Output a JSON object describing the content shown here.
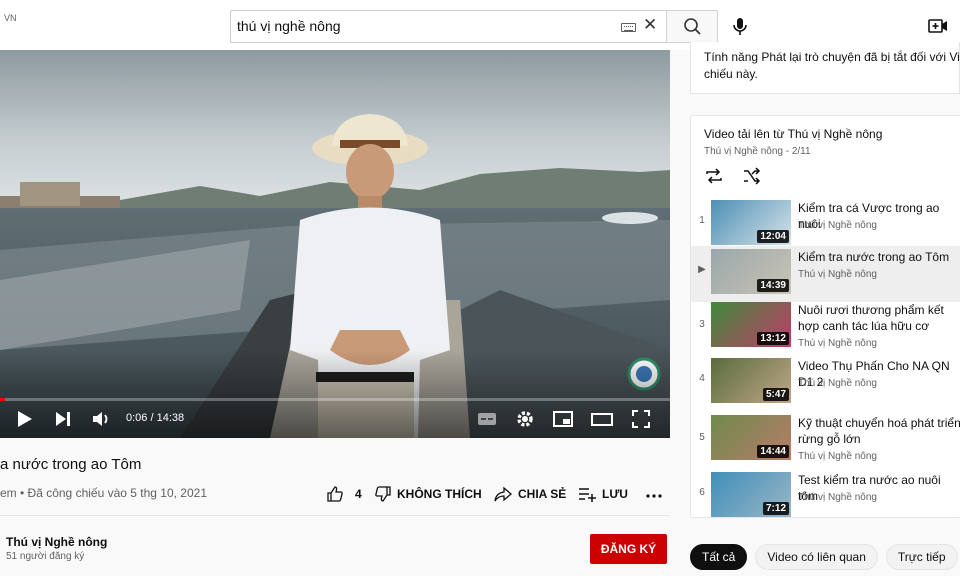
{
  "header": {
    "region_label": "VN",
    "search": {
      "value": "thú vị nghề nông",
      "placeholder": ""
    },
    "icons": [
      "keyboard-icon",
      "clear-icon",
      "search-icon",
      "mic-icon",
      "create-video-icon"
    ]
  },
  "player": {
    "time_current": "0:06",
    "time_total": "14:38",
    "time_label": "0:06 / 14:38",
    "progress_fraction": 0.007,
    "accent_color": "#ff0000"
  },
  "video": {
    "title": "a nước trong ao Tôm",
    "meta": "em • Đã công chiếu vào 5 thg 10, 2021",
    "likes": "4",
    "dislike_label": "KHÔNG THÍCH",
    "share_label": "CHIA SẺ",
    "save_label": "LƯU"
  },
  "channel": {
    "name": "Thú vị Nghề nông",
    "subscribers": "51 người đăng ký",
    "subscribe_label": "ĐĂNG KÝ",
    "subscribe_color": "#cc0000"
  },
  "chat": {
    "line1": "Tính năng Phát lại trò chuyện đã bị tắt đối với Video",
    "line2": "chiếu này."
  },
  "playlist": {
    "title": "Video tải lên từ Thú vị Nghề nông",
    "owner": "Thú vị Nghề nông",
    "position": "2/11",
    "items": [
      {
        "index": "1",
        "title": "Kiểm tra cá Vược trong ao nuôi",
        "channel": "Thú vị Nghề nông",
        "duration": "12:04",
        "active": false
      },
      {
        "index": "▶",
        "title": "Kiểm tra nước trong ao Tôm",
        "channel": "Thú vị Nghề nông",
        "duration": "14:39",
        "active": true
      },
      {
        "index": "3",
        "title": "Nuôi rươi thương phẩm kết hợp canh tác lúa hữu cơ",
        "channel": "Thú vị Nghề nông",
        "duration": "13:12",
        "active": false
      },
      {
        "index": "4",
        "title": "Video Thụ Phấn Cho NA QN D1 2",
        "channel": "Thú vị Nghề nông",
        "duration": "5:47",
        "active": false
      },
      {
        "index": "5",
        "title": "Kỹ thuật chuyển hoá phát triển rừng gỗ lớn",
        "channel": "Thú vị Nghề nông",
        "duration": "14:44",
        "active": false
      },
      {
        "index": "6",
        "title": "Test kiểm tra nước ao nuôi tôm",
        "channel": "Thú vị Nghề nông",
        "duration": "7:12",
        "active": false
      }
    ]
  },
  "chips": [
    "Tất cả",
    "Video có liên quan",
    "Trực tiếp"
  ]
}
